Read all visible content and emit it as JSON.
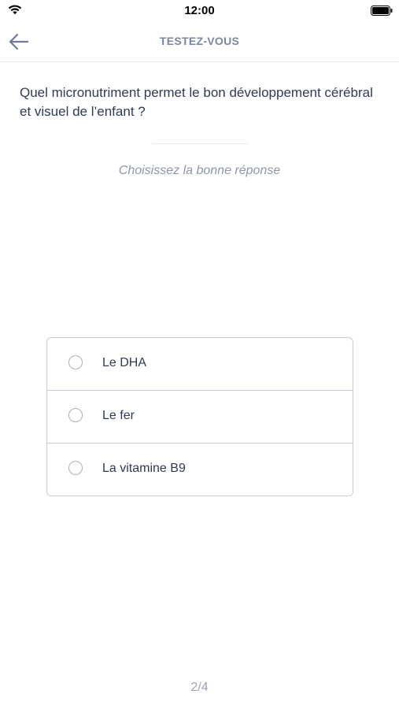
{
  "status_bar": {
    "time": "12:00",
    "wifi_icon": "wifi-icon",
    "battery_icon": "battery-icon"
  },
  "nav": {
    "back_icon": "arrow-left-icon",
    "title": "TESTEZ-VOUS"
  },
  "quiz": {
    "question": "Quel micronutriment permet le bon développement cérébral et visuel de l’enfant ?",
    "instruction": "Choisissez la bonne réponse",
    "answers": [
      {
        "label": "Le DHA"
      },
      {
        "label": "Le fer"
      },
      {
        "label": "La vitamine B9"
      }
    ],
    "pager": "2/4"
  },
  "colors": {
    "title_text": "#7b86a0",
    "body_text": "#2f3a55",
    "muted_text": "#8d96ab",
    "border": "#c7ccd8",
    "accent": "#6c7a96"
  }
}
